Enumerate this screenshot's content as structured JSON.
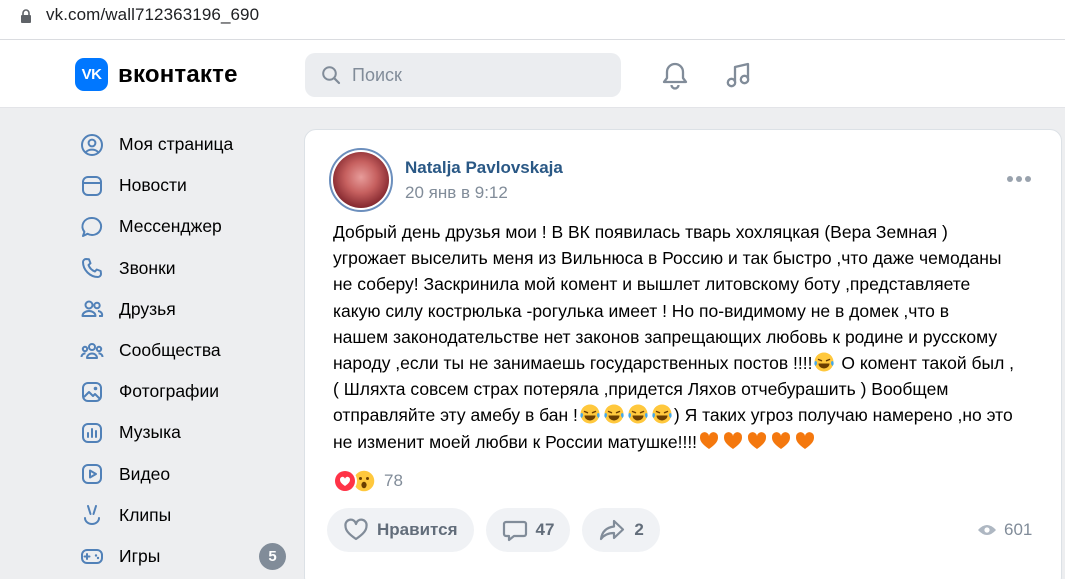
{
  "browser": {
    "url": "vk.com/wall712363196_690"
  },
  "header": {
    "logo_text": "вконтакте",
    "logo_badge": "VK",
    "search_placeholder": "Поиск",
    "icons": [
      "bell-icon",
      "music-icon"
    ]
  },
  "sidebar": {
    "items": [
      {
        "label": "Моя страница",
        "icon": "user-circle-icon"
      },
      {
        "label": "Новости",
        "icon": "news-icon"
      },
      {
        "label": "Мессенджер",
        "icon": "message-icon"
      },
      {
        "label": "Звонки",
        "icon": "phone-icon"
      },
      {
        "label": "Друзья",
        "icon": "friends-icon"
      },
      {
        "label": "Сообщества",
        "icon": "communities-icon"
      },
      {
        "label": "Фотографии",
        "icon": "photo-icon"
      },
      {
        "label": "Музыка",
        "icon": "music-list-icon"
      },
      {
        "label": "Видео",
        "icon": "video-icon"
      },
      {
        "label": "Клипы",
        "icon": "clips-icon"
      },
      {
        "label": "Игры",
        "icon": "gamepad-icon",
        "badge": "5"
      }
    ]
  },
  "post": {
    "author": "Natalja Pavlovskaja",
    "date": "20 янв в 9:12",
    "text_lines": [
      "Добрый день друзья мои ! В ВК появилась тварь хохляцкая (Вера Земная )",
      "угрожает выселить меня из Вильнюса в Россию и так быстро ,что даже чемоданы",
      "не соберу! Заскринила мой комент и вышлет литовскому боту ,представляете",
      "какую силу кострюлька -рогулька имеет ! Но по-видимому не в домек ,что в",
      "нашем законодательстве нет законов запрещающих любовь к родине и русскому",
      "народу ,если ты не занимаешь государственных постов !!!!",
      " О комент такой был ,",
      "( Шляхта совсем страх потеряла ,придется Ляхов отчебурашить ) Вообщем",
      "отправляйте эту амебу в бан !",
      ") Я таких угроз получаю намерено ,но это",
      "не изменит моей любви к России матушке!!!!"
    ],
    "reactions_count": "78",
    "like_label": "Нравится",
    "comments_count": "47",
    "shares_count": "2",
    "views_count": "601"
  },
  "colors": {
    "brand": "#0077ff",
    "link": "#2a5885",
    "muted": "#818c99",
    "page_bg": "#edeef0"
  }
}
